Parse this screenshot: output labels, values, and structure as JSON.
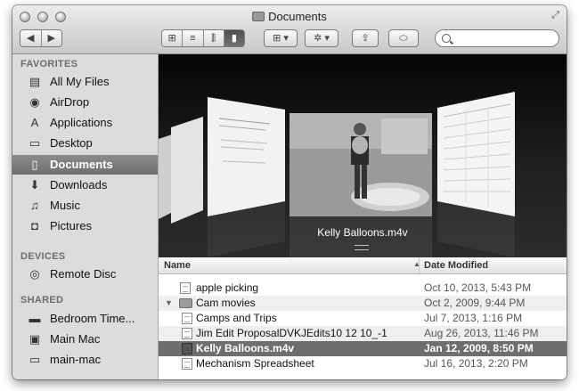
{
  "window": {
    "title": "Documents"
  },
  "toolbar": {
    "back_label": "◀",
    "forward_label": "▶",
    "view_icon_label": "⊞",
    "view_list_label": "≡",
    "view_column_label": "⫼",
    "view_coverflow_label": "▮",
    "arrange_label": "⊞ ▾",
    "action_label": "✲ ▾",
    "share_label": "⇪",
    "tags_label": "⬭",
    "search": {
      "placeholder": "",
      "value": ""
    }
  },
  "sidebar": {
    "favorites_heading": "FAVORITES",
    "favorites": [
      {
        "label": "All My Files",
        "icon": "all-files-icon",
        "glyph": "▤"
      },
      {
        "label": "AirDrop",
        "icon": "airdrop-icon",
        "glyph": "◉"
      },
      {
        "label": "Applications",
        "icon": "applications-icon",
        "glyph": "A"
      },
      {
        "label": "Desktop",
        "icon": "desktop-icon",
        "glyph": "▭"
      },
      {
        "label": "Documents",
        "icon": "documents-icon",
        "glyph": "▯"
      },
      {
        "label": "Downloads",
        "icon": "downloads-icon",
        "glyph": "⬇"
      },
      {
        "label": "Music",
        "icon": "music-icon",
        "glyph": "♫"
      },
      {
        "label": "Pictures",
        "icon": "pictures-icon",
        "glyph": "◘"
      }
    ],
    "devices_heading": "DEVICES",
    "devices": [
      {
        "label": "Remote Disc",
        "icon": "disc-icon",
        "glyph": "◎"
      }
    ],
    "shared_heading": "SHARED",
    "shared": [
      {
        "label": "Bedroom Time...",
        "icon": "network-drive-icon",
        "glyph": "▬"
      },
      {
        "label": "Main Mac",
        "icon": "computer-icon",
        "glyph": "▣"
      },
      {
        "label": "main-mac",
        "icon": "computer-icon",
        "glyph": "▭"
      }
    ],
    "selected": "Documents"
  },
  "coverflow": {
    "current_name": "Kelly Balloons.m4v"
  },
  "list": {
    "col_name": "Name",
    "col_date": "Date Modified",
    "sort_indicator": "▲",
    "rows": [
      {
        "name": "apple picking",
        "date": "Oct 10, 2013, 5:43 PM",
        "kind": "doc",
        "level": 0
      },
      {
        "name": "Cam movies",
        "date": "Oct 2, 2009, 9:44 PM",
        "kind": "folder",
        "level": 0,
        "expanded": true
      },
      {
        "name": "Camps and Trips",
        "date": "Jul 7, 2013, 1:16 PM",
        "kind": "doc",
        "level": 1
      },
      {
        "name": "Jim Edit ProposalDVKJEdits10 12 10_-1",
        "date": "Aug 26, 2013, 11:46 PM",
        "kind": "doc",
        "level": 1
      },
      {
        "name": "Kelly Balloons.m4v",
        "date": "Jan 12, 2009, 8:50 PM",
        "kind": "movie",
        "level": 1,
        "selected": true
      },
      {
        "name": "Mechanism Spreadsheet",
        "date": "Jul 16, 2013, 2:20 PM",
        "kind": "doc",
        "level": 1
      }
    ]
  },
  "colors": {
    "selection": "#6e6e6e",
    "sidebar_bg": "#dcdcdc",
    "coverflow_bg": "#111111"
  }
}
